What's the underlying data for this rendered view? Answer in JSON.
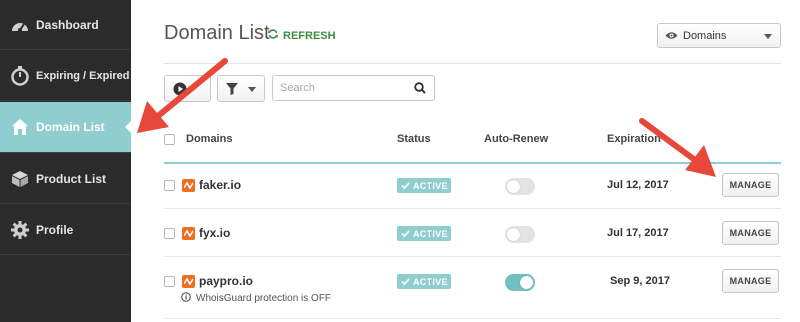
{
  "sidebar": {
    "items": [
      {
        "label": "Dashboard",
        "icon": "dashboard-gauge-icon"
      },
      {
        "label": "Expiring / Expired",
        "icon": "stopwatch-icon"
      },
      {
        "label": "Domain List",
        "icon": "house-icon",
        "active": true
      },
      {
        "label": "Product List",
        "icon": "box-icon"
      },
      {
        "label": "Profile",
        "icon": "gear-icon"
      }
    ]
  },
  "header": {
    "title": "Domain List",
    "refresh_label": "REFRESH",
    "domains_select": "Domains"
  },
  "toolbar": {
    "search_placeholder": "Search"
  },
  "table": {
    "columns": [
      "Domains",
      "Status",
      "Auto-Renew",
      "Expiration"
    ],
    "rows": [
      {
        "domain": "faker.io",
        "status": "ACTIVE",
        "auto_renew": false,
        "expiration": "Jul 12, 2017",
        "action": "MANAGE"
      },
      {
        "domain": "fyx.io",
        "status": "ACTIVE",
        "auto_renew": false,
        "expiration": "Jul 17, 2017",
        "action": "MANAGE"
      },
      {
        "domain": "paypro.io",
        "status": "ACTIVE",
        "auto_renew": true,
        "expiration": "Sep 9, 2017",
        "action": "MANAGE",
        "note": "WhoisGuard protection is OFF"
      }
    ]
  },
  "colors": {
    "sidebar_bg": "#2b2b2b",
    "accent": "#8fcdd0",
    "brand_orange": "#f26c22",
    "annotation_arrow": "#e8473b",
    "refresh_green": "#3d8d3f"
  }
}
